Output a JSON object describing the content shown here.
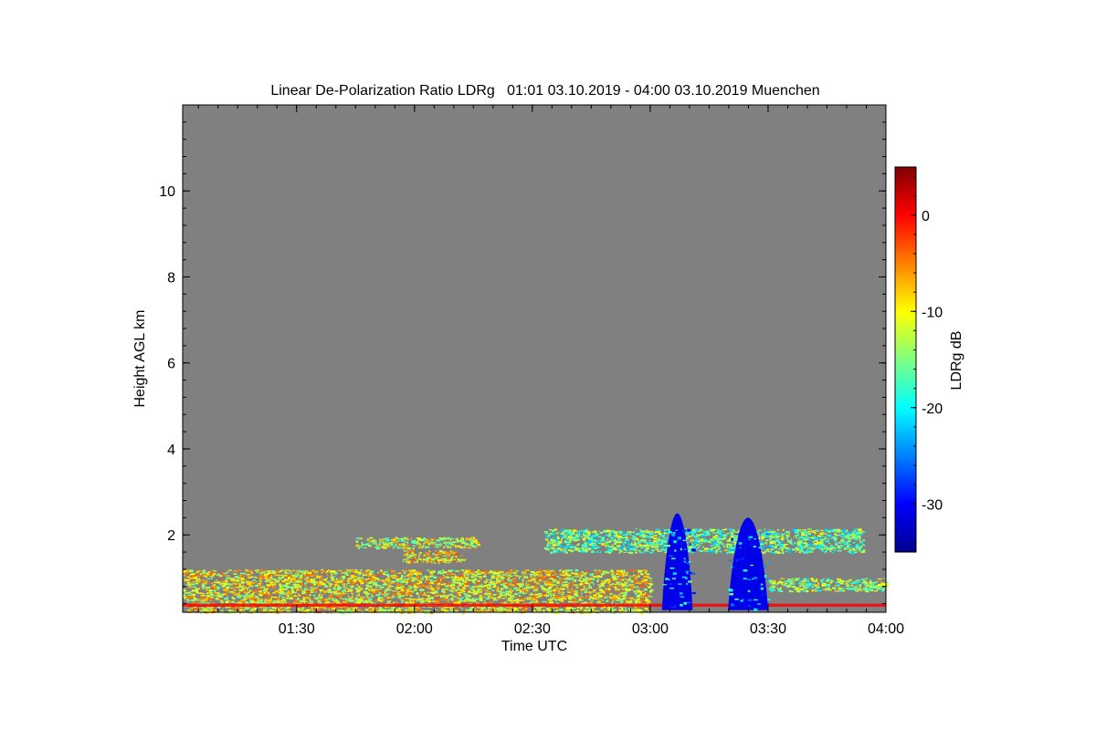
{
  "chart_data": {
    "type": "heatmap",
    "title": "Linear De-Polarization Ratio LDRg   01:01 03.10.2019 - 04:00 03.10.2019 Muenchen",
    "xlabel": "Time UTC",
    "ylabel": "Height AGL km",
    "x_tick_labels": [
      "01:30",
      "02:00",
      "02:30",
      "03:00",
      "03:30",
      "04:00"
    ],
    "x_tick_hours": [
      1.5,
      2.0,
      2.5,
      3.0,
      3.5,
      4.0
    ],
    "xlim_hours": [
      1.0167,
      4.0
    ],
    "y_ticks": [
      2,
      4,
      6,
      8,
      10
    ],
    "ylim": [
      0.2,
      12.0
    ],
    "background_color": "#808080",
    "colorbar": {
      "label": "LDRg dB",
      "ticks": [
        0,
        -10,
        -20,
        -30
      ],
      "range": [
        -35,
        5
      ],
      "colors": [
        "#00008f",
        "#0000ff",
        "#0080ff",
        "#00ffff",
        "#80ff80",
        "#ffff00",
        "#ff8000",
        "#ff0000",
        "#800000"
      ]
    },
    "features": [
      {
        "kind": "surface_layer",
        "t": [
          1.0167,
          3.0
        ],
        "h": [
          0.2,
          1.2
        ],
        "ldr": -10
      },
      {
        "kind": "red_band",
        "t": [
          1.0167,
          4.0
        ],
        "h": [
          0.33,
          0.4
        ],
        "ldr": 0
      },
      {
        "kind": "cloud_layer",
        "t": [
          1.75,
          2.27
        ],
        "h": [
          1.7,
          1.95
        ],
        "ldr": -12
      },
      {
        "kind": "cloud_layer",
        "t": [
          1.95,
          2.2
        ],
        "h": [
          1.35,
          1.65
        ],
        "ldr": -9
      },
      {
        "kind": "cloud_layer",
        "t": [
          2.55,
          3.9
        ],
        "h": [
          1.6,
          2.15
        ],
        "ldr": -16
      },
      {
        "kind": "convective_plume",
        "t": [
          3.05,
          3.18
        ],
        "h": [
          0.25,
          2.5
        ],
        "ldr": -31
      },
      {
        "kind": "convective_plume",
        "t": [
          3.33,
          3.5
        ],
        "h": [
          0.25,
          2.4
        ],
        "ldr": -31
      },
      {
        "kind": "low_cloud",
        "t": [
          3.5,
          4.0
        ],
        "h": [
          0.7,
          1.0
        ],
        "ldr": -14
      }
    ]
  }
}
